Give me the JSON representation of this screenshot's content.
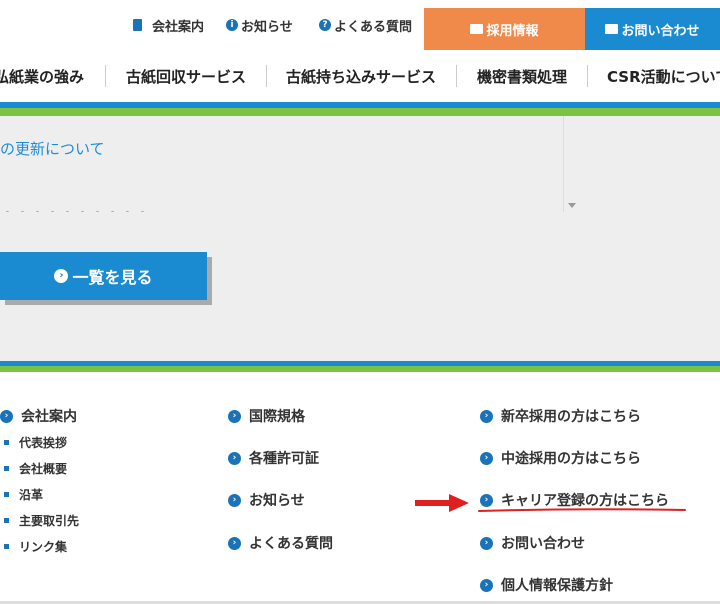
{
  "top_nav": {
    "company": "会社案内",
    "news": "お知らせ",
    "faq": "よくある質問",
    "recruit": "採用情報",
    "contact": "お問い合わせ"
  },
  "main_nav": [
    "弘紙業の強み",
    "古紙回収サービス",
    "古紙持ち込みサービス",
    "機密書類処理",
    "CSR活動について"
  ],
  "news": {
    "items": [
      "・・・・・・・・・・・・・・・・・・・・・・",
      "の更新について",
      "・・・・・・・・・・"
    ],
    "list_button": "一覧を見る"
  },
  "footer": {
    "col1": {
      "title": "会社案内",
      "subitems": [
        "代表挨拶",
        "会社概要",
        "沿革",
        "主要取引先",
        "リンク集"
      ]
    },
    "col2": [
      "国際規格",
      "各種許可証",
      "お知らせ",
      "よくある質問"
    ],
    "col3": [
      "新卒採用の方はこちら",
      "中途採用の方はこちら",
      "キャリア登録の方はこちら",
      "お問い合わせ",
      "個人情報保護方針"
    ]
  },
  "colors": {
    "accent_blue": "#1a8bd0",
    "recruit_orange": "#f08a4b",
    "stripe_green": "#7cc243",
    "annotation_red": "#e02020"
  }
}
